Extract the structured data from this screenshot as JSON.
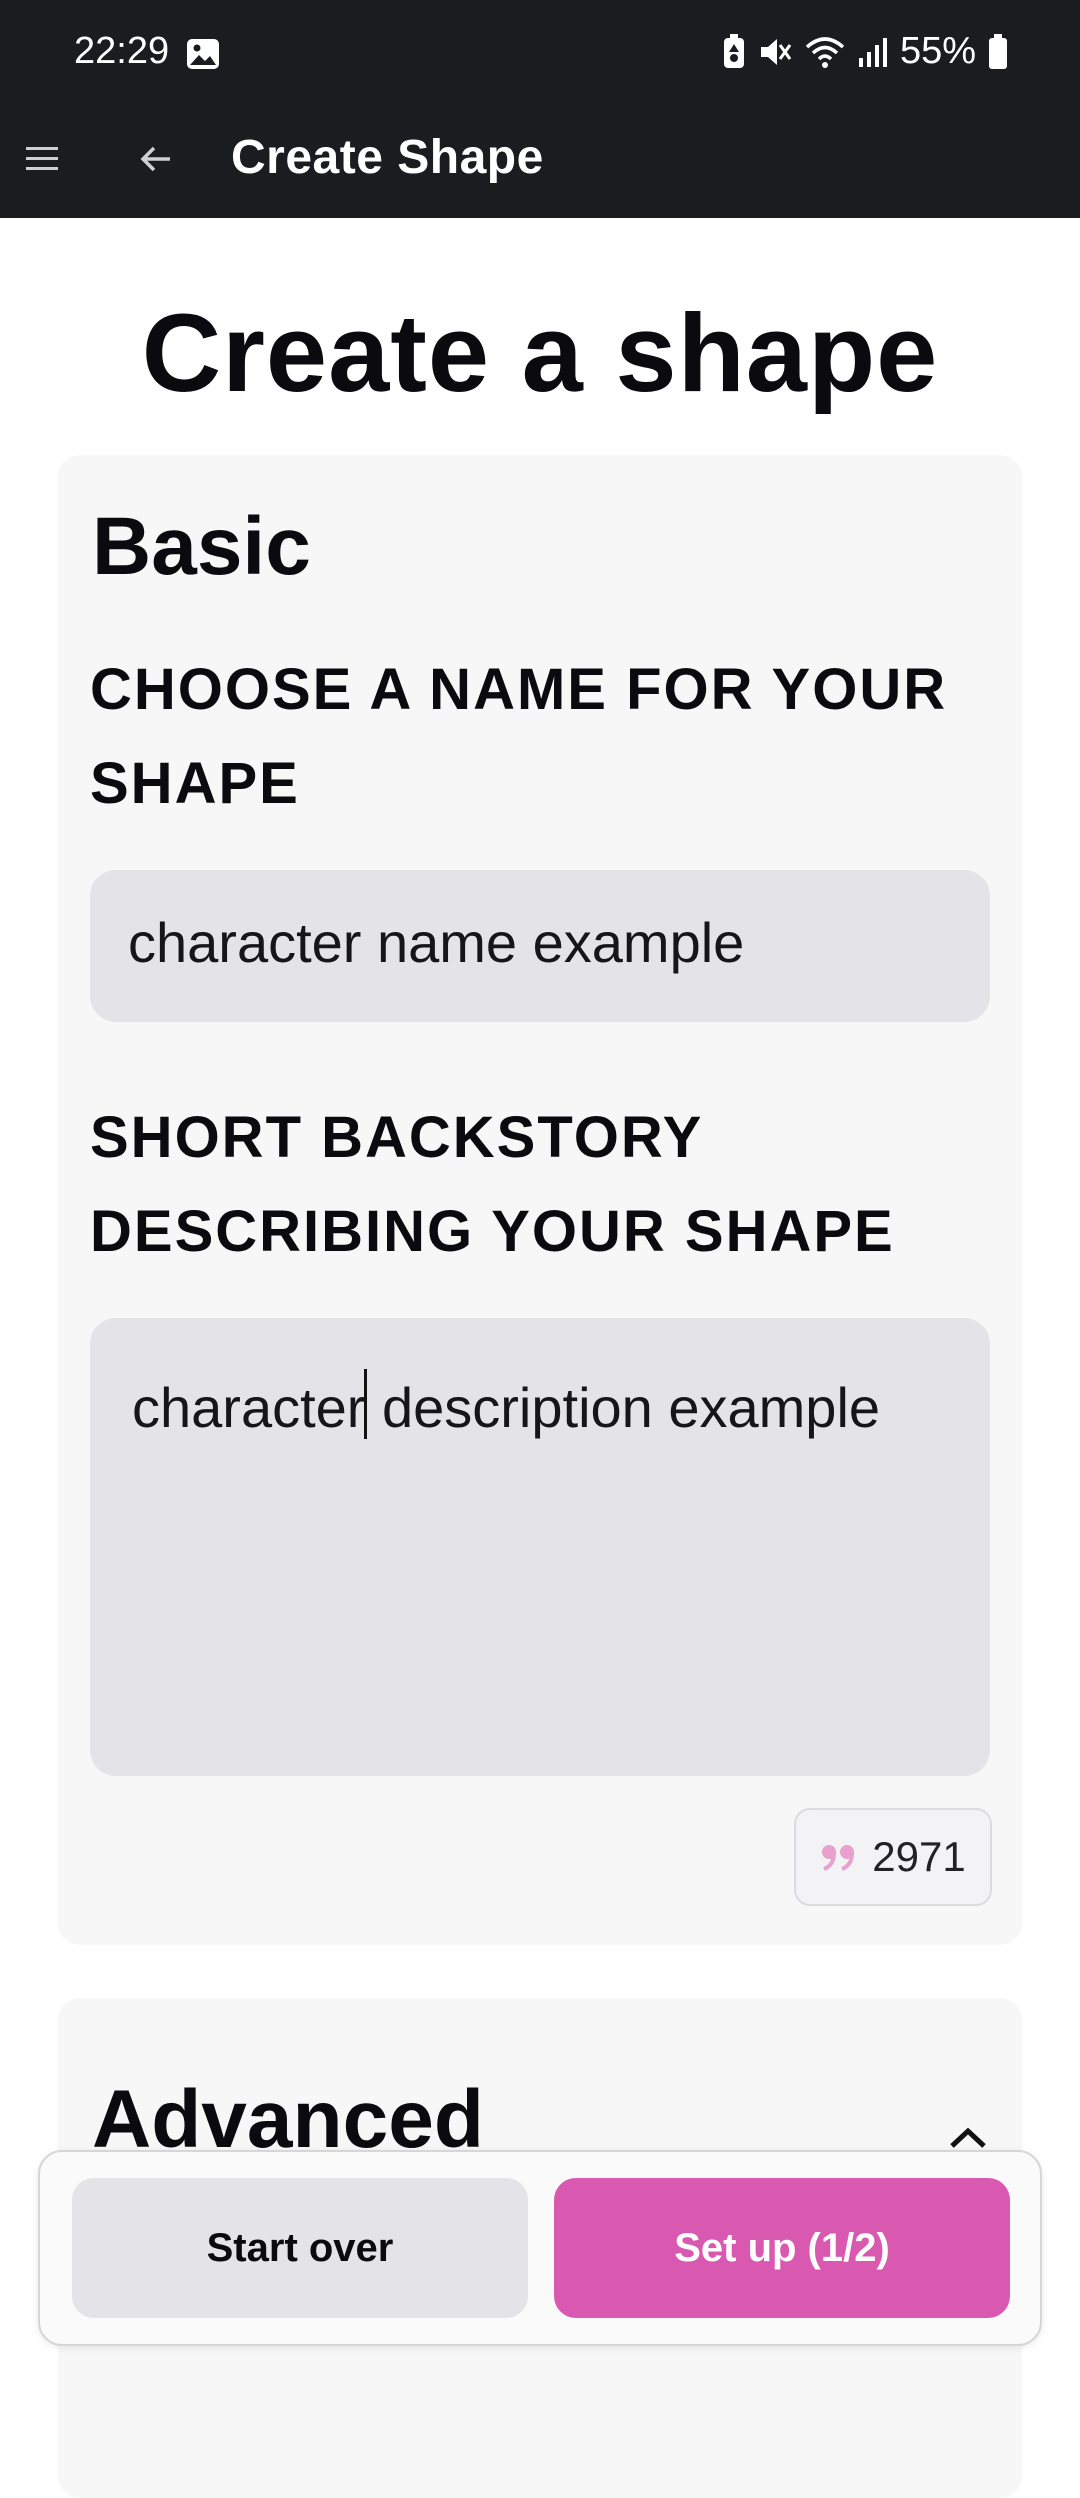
{
  "status_bar": {
    "time": "22:29",
    "battery": "55%"
  },
  "app_bar": {
    "title": "Create Shape"
  },
  "page": {
    "title": "Create a shape"
  },
  "basic": {
    "heading": "Basic",
    "name_label": "CHOOSE A NAME FOR YOUR SHAPE",
    "name_value": "character name example",
    "backstory_label": "SHORT BACKSTORY DESCRIBING YOUR SHAPE",
    "backstory_before_cursor": "character",
    "backstory_after_cursor": " description example",
    "char_count": "2971"
  },
  "advanced": {
    "heading": "Advanced"
  },
  "actions": {
    "start_over": "Start over",
    "set_up": "Set up (1/2)"
  },
  "colors": {
    "top_bar": "#1b1c20",
    "accent": "#d958b0",
    "input_bg": "#e4e4e8",
    "card_bg": "#f7f7f7"
  },
  "icons": [
    "gallery-icon",
    "battery-saver-icon",
    "mute-icon",
    "wifi-icon",
    "signal-icon",
    "battery-icon",
    "menu-icon",
    "back-arrow-icon",
    "quote-icon",
    "chevron-up-icon"
  ]
}
